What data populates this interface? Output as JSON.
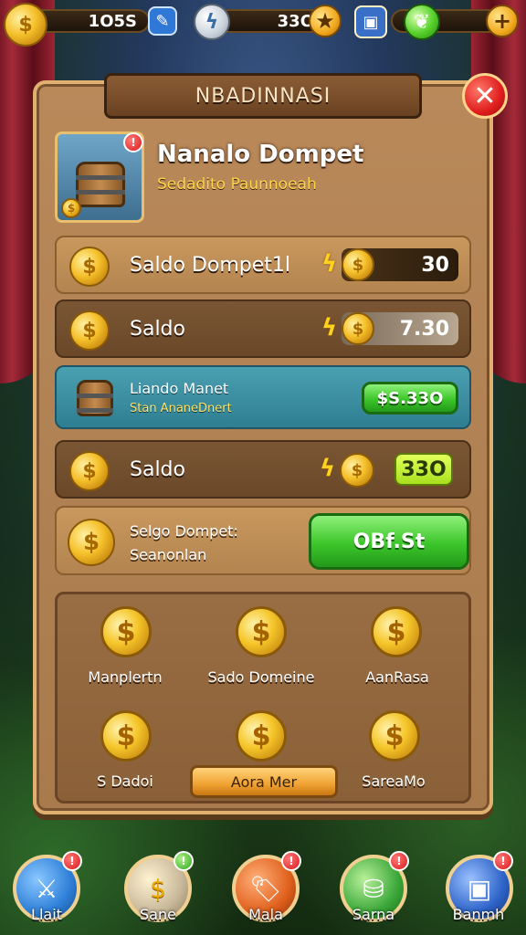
{
  "top_bar": {
    "coins_value": "1O5S",
    "energy_value": "33O",
    "plus_symbol": "+"
  },
  "dialog": {
    "title": "NBADINNASI",
    "close_symbol": "✕",
    "header": {
      "title": "Nanalo Dompet",
      "subtitle": "Sedadito Paunnoeah",
      "badge": "!"
    }
  },
  "rows": [
    {
      "label": "Saldo Dompet1l",
      "value": "30",
      "style": "tan"
    },
    {
      "label": "Saldo",
      "value": "7.30",
      "style": "brown"
    },
    {
      "title": "Liando Manet",
      "subtitle": "Stan AnaneDnert",
      "button": "$S.33O",
      "style": "teal"
    },
    {
      "label": "Saldo",
      "value": "33O",
      "style": "brown"
    },
    {
      "title": "Selgo Dompet:",
      "subtitle": "Seanonlan",
      "button": "OBf.St",
      "style": "tan"
    }
  ],
  "grid": {
    "items": [
      {
        "label": "Manplertn"
      },
      {
        "label": "Sado Domeine"
      },
      {
        "label": "AanRasa"
      },
      {
        "label": "S Dadoi"
      },
      {
        "label": ""
      },
      {
        "label": "SareaMo"
      }
    ],
    "center_button": "Aora Mer"
  },
  "bottom_nav": [
    {
      "label": "Llait",
      "badge": "!",
      "icon": "sword-icon",
      "color": "#2e7fd8"
    },
    {
      "label": "Sane",
      "badge": "!",
      "icon": "coin-icon",
      "color": "#c8b89a"
    },
    {
      "label": "Mala",
      "badge": "!",
      "icon": "tag-icon",
      "color": "#e0601c"
    },
    {
      "label": "Sarna",
      "badge": "!",
      "icon": "bucket-icon",
      "color": "#3ca83a"
    },
    {
      "label": "Banmh",
      "badge": "!",
      "icon": "chest-icon",
      "color": "#2e64c8"
    }
  ]
}
